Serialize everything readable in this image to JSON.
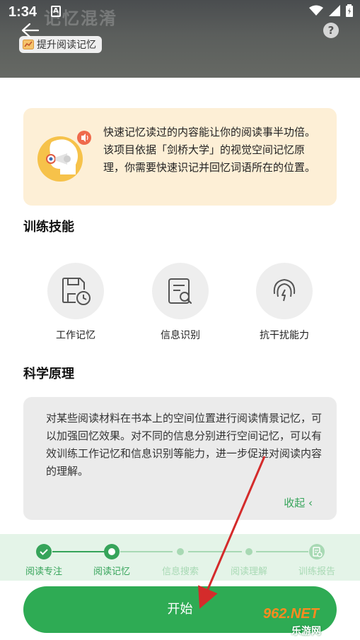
{
  "status_bar": {
    "time": "1:34",
    "notification": "A"
  },
  "header": {
    "ghost_title": "记忆混淆",
    "badge_label": "提升阅读记忆",
    "help_label": "?"
  },
  "intro": {
    "text": "快速记忆读过的内容能让你的阅读事半功倍。该项目依据「剑桥大学」的视觉空间记忆原理，你需要快速识记并回忆词语所在的位置。"
  },
  "skills": {
    "title": "训练技能",
    "items": [
      {
        "label": "工作记忆",
        "icon": "save-clock-icon"
      },
      {
        "label": "信息识别",
        "icon": "document-search-icon"
      },
      {
        "label": "抗干扰能力",
        "icon": "ear-bolt-icon"
      }
    ]
  },
  "principle": {
    "title": "科学原理",
    "text": "对某些阅读材料在书本上的空间位置进行阅读情景记忆，可以加强回忆效果。对不同的信息分别进行空间记忆，可以有效训练工作记忆和信息识别等能力，进一步促进对阅读内容的理解。",
    "collapse_label": "收起 ‹"
  },
  "progress": {
    "steps": [
      {
        "label": "阅读专注",
        "state": "done"
      },
      {
        "label": "阅读记忆",
        "state": "current"
      },
      {
        "label": "信息搜索",
        "state": "todo"
      },
      {
        "label": "阅读理解",
        "state": "todo"
      },
      {
        "label": "训练报告",
        "state": "report"
      }
    ],
    "colors": {
      "active": "#36a45a",
      "inactive": "#a8d9b4",
      "background": "#e4f4e8"
    }
  },
  "start_button": {
    "label": "开始"
  },
  "watermark": {
    "top": "962.NET",
    "bottom": "乐游网"
  }
}
